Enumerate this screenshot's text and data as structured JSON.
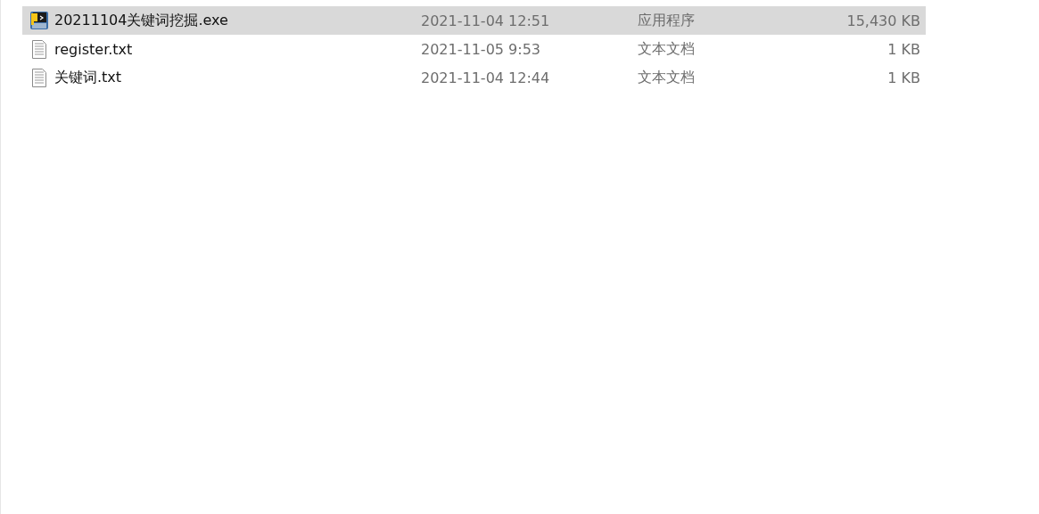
{
  "files": [
    {
      "name": "20211104关键词挖掘.exe",
      "kind": "exe",
      "date": "2021-11-04 12:51",
      "type": "应用程序",
      "size": "15,430 KB",
      "selected": true
    },
    {
      "name": "register.txt",
      "kind": "txt",
      "date": "2021-11-05 9:53",
      "type": "文本文档",
      "size": "1 KB",
      "selected": false
    },
    {
      "name": "关键词.txt",
      "kind": "txt",
      "date": "2021-11-04 12:44",
      "type": "文本文档",
      "size": "1 KB",
      "selected": false
    }
  ]
}
